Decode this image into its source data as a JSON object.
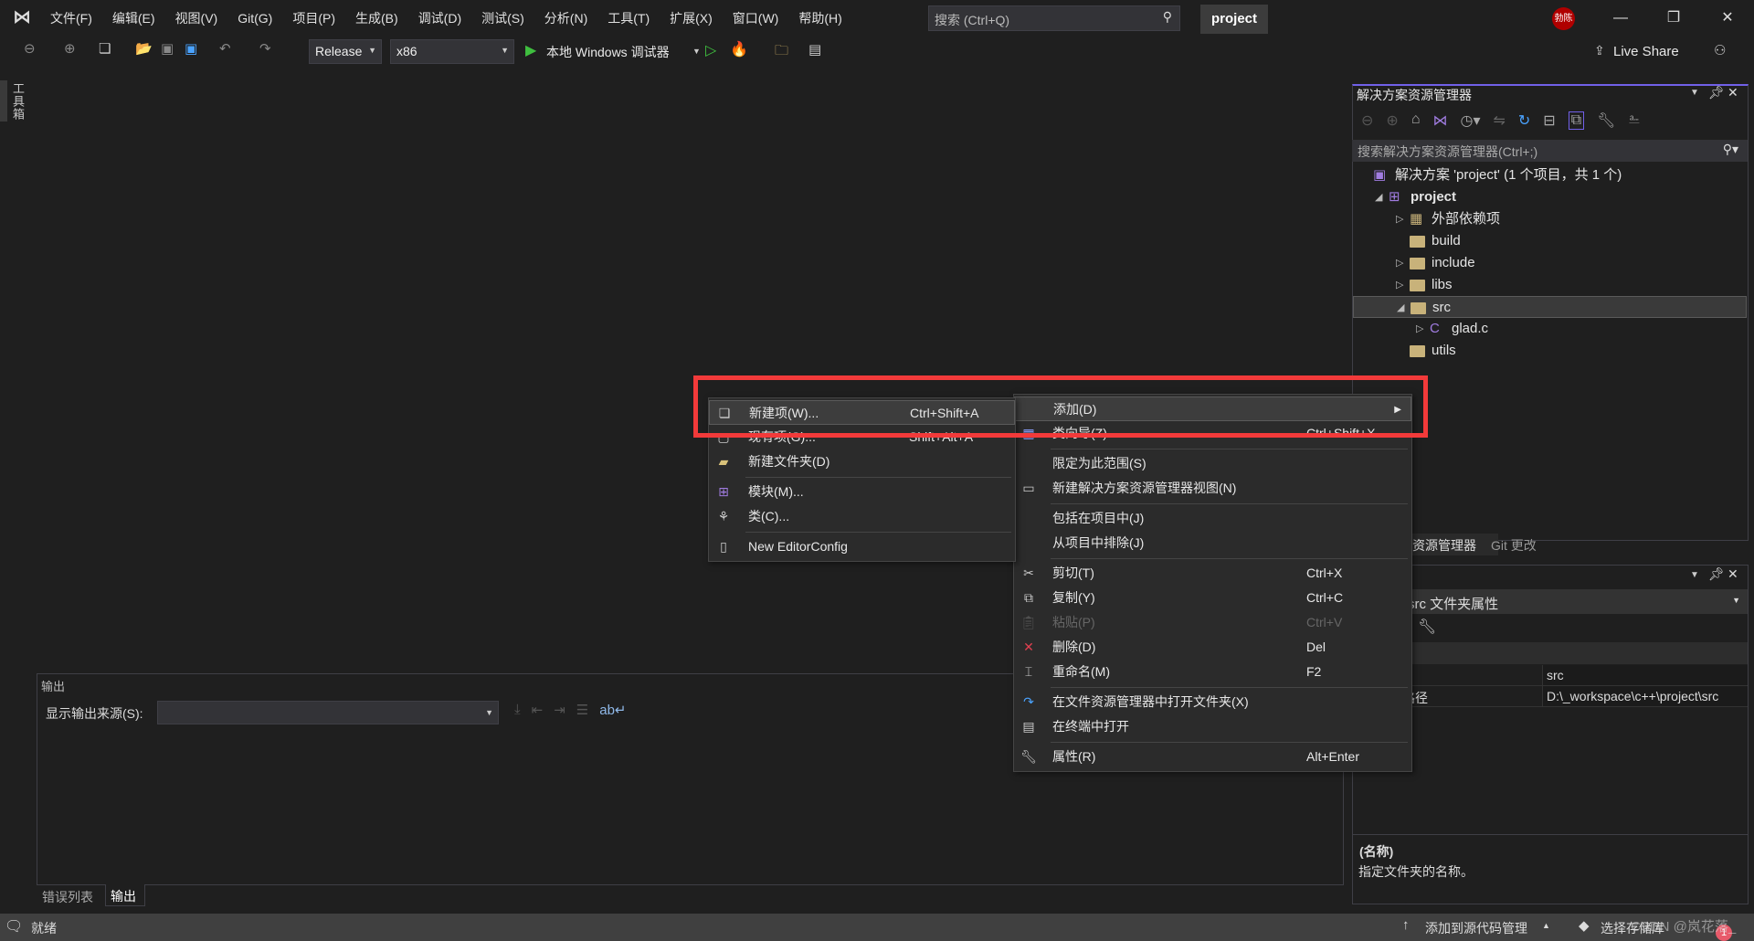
{
  "titlebar": {
    "menu": [
      "文件(F)",
      "编辑(E)",
      "视图(V)",
      "Git(G)",
      "项目(P)",
      "生成(B)",
      "调试(D)",
      "测试(S)",
      "分析(N)",
      "工具(T)",
      "扩展(X)",
      "窗口(W)",
      "帮助(H)"
    ],
    "search_placeholder": "搜索 (Ctrl+Q)",
    "solution_name": "project",
    "avatar_text": "勃陈"
  },
  "toolbar": {
    "configuration": "Release",
    "platform": "x86",
    "debugger": "本地 Windows 调试器",
    "live_share": "Live Share"
  },
  "toolbox_label": "工具箱",
  "solution_explorer": {
    "title": "解决方案资源管理器",
    "search_placeholder": "搜索解决方案资源管理器(Ctrl+;)",
    "tree": [
      {
        "label": "解决方案 'project' (1 个项目，共 1 个)",
        "level": 0,
        "icon": "solution-icon"
      },
      {
        "label": "project",
        "level": 1,
        "expanded": true,
        "icon": "cpp-project-icon",
        "bold": true
      },
      {
        "label": "外部依赖项",
        "level": 2,
        "expandable": true,
        "icon": "external-deps-icon"
      },
      {
        "label": "build",
        "level": 2,
        "icon": "folder-icon"
      },
      {
        "label": "include",
        "level": 2,
        "expandable": true,
        "icon": "folder-icon"
      },
      {
        "label": "libs",
        "level": 2,
        "expandable": true,
        "icon": "folder-icon"
      },
      {
        "label": "src",
        "level": 2,
        "expanded": true,
        "selected": true,
        "icon": "folder-icon"
      },
      {
        "label": "glad.c",
        "level": 3,
        "expandable": true,
        "icon": "c-file-icon"
      },
      {
        "label": "utils",
        "level": 2,
        "icon": "folder-icon"
      }
    ],
    "tabs": [
      "解决方案资源管理器",
      "Git 更改"
    ]
  },
  "properties": {
    "object": "src 文件夹属性",
    "rows": [
      {
        "name": "(名称)",
        "value": "src"
      },
      {
        "name": "完整路径",
        "value": "D:\\_workspace\\c++\\project\\src"
      }
    ],
    "desc_title": "(名称)",
    "desc_text": "指定文件夹的名称。"
  },
  "output": {
    "title": "输出",
    "source_label": "显示输出来源(S):",
    "source_value": "",
    "tabs": [
      "错误列表",
      "输出"
    ],
    "active_tab": "输出"
  },
  "context_menu": [
    {
      "label": "添加(D)",
      "submenu": true,
      "highlighted": true
    },
    {
      "label": "类向导(Z)...",
      "shortcut": "Ctrl+Shift+X",
      "icon": "class-wizard-icon"
    },
    {
      "sep": true
    },
    {
      "label": "限定为此范围(S)"
    },
    {
      "label": "新建解决方案资源管理器视图(N)",
      "icon": "new-view-icon"
    },
    {
      "sep": true
    },
    {
      "label": "包括在项目中(J)"
    },
    {
      "label": "从项目中排除(J)"
    },
    {
      "sep": true
    },
    {
      "label": "剪切(T)",
      "shortcut": "Ctrl+X",
      "icon": "scissors-icon"
    },
    {
      "label": "复制(Y)",
      "shortcut": "Ctrl+C",
      "icon": "copy-icon"
    },
    {
      "label": "粘贴(P)",
      "shortcut": "Ctrl+V",
      "icon": "paste-icon",
      "disabled": true
    },
    {
      "label": "删除(D)",
      "shortcut": "Del",
      "icon": "delete-icon"
    },
    {
      "label": "重命名(M)",
      "shortcut": "F2",
      "icon": "rename-icon"
    },
    {
      "sep": true
    },
    {
      "label": "在文件资源管理器中打开文件夹(X)",
      "icon": "open-folder-icon"
    },
    {
      "label": "在终端中打开",
      "icon": "terminal-icon"
    },
    {
      "sep": true
    },
    {
      "label": "属性(R)",
      "shortcut": "Alt+Enter",
      "icon": "wrench-icon"
    }
  ],
  "add_submenu": [
    {
      "label": "新建项(W)...",
      "shortcut": "Ctrl+Shift+A",
      "icon": "new-item-icon",
      "highlighted": true
    },
    {
      "label": "现有项(G)...",
      "shortcut": "Shift+Alt+A",
      "icon": "existing-item-icon"
    },
    {
      "label": "新建文件夹(D)",
      "icon": "new-folder-icon"
    },
    {
      "sep": true
    },
    {
      "label": "模块(M)...",
      "icon": "module-icon"
    },
    {
      "label": "类(C)...",
      "icon": "class-icon"
    },
    {
      "sep": true
    },
    {
      "label": "New EditorConfig",
      "icon": "file-icon"
    }
  ],
  "status": {
    "text": "就绪",
    "source_control": "添加到源代码管理",
    "repository": "选择存储库",
    "notifications": "1"
  },
  "watermark": "CSDN @岚花落_",
  "colors": {
    "accent": "#7160e8",
    "highlight_box": "#f23a3a",
    "status_bar": "#404040"
  }
}
